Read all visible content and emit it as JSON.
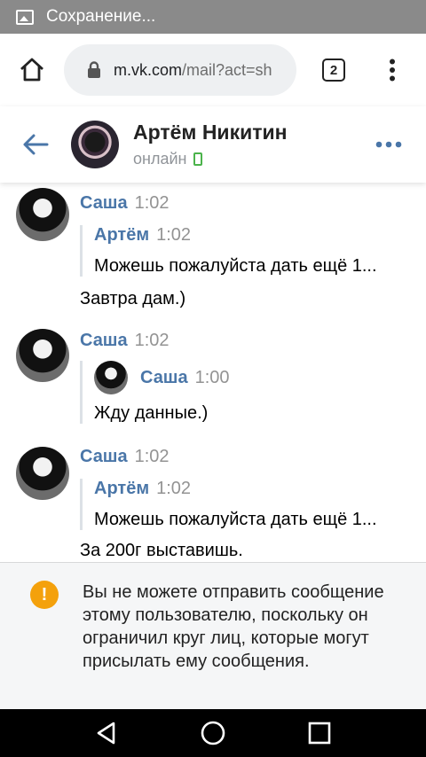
{
  "status_bar": {
    "text": "Сохранение..."
  },
  "browser": {
    "url_domain": "m.vk.com",
    "url_path": "/mail?act=sh",
    "tab_count": "2"
  },
  "chat_header": {
    "name": "Артём Никитин",
    "status": "онлайн"
  },
  "messages": [
    {
      "author": "Саша",
      "time": "1:02",
      "forwarded": {
        "author": "Артём",
        "time": "1:02",
        "text": "Можешь пожалуйста дать ещё 1..."
      },
      "text": "Завтра дам.)"
    },
    {
      "author": "Саша",
      "time": "1:02",
      "forwarded": {
        "author": "Саша",
        "time": "1:00",
        "text": "Жду данные.)"
      },
      "text": ""
    },
    {
      "author": "Саша",
      "time": "1:02",
      "forwarded": {
        "author": "Артём",
        "time": "1:02",
        "text": "Можешь пожалуйста дать ещё 1..."
      },
      "text": "За 200г выставишь."
    }
  ],
  "notice": {
    "text": "Вы не можете отправить сообщение этому пользователю, поскольку он ограничил круг лиц, которые могут присылать ему сообщения.",
    "icon": "!"
  },
  "colors": {
    "accent": "#4a76a8",
    "online": "#4bb34b",
    "warning": "#f4a10c"
  }
}
